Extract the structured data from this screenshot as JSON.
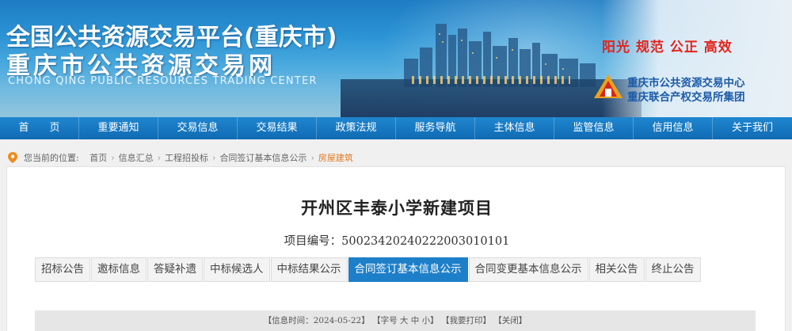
{
  "banner": {
    "title_line1": "全国公共资源交易平台(重庆市)",
    "title_line2": "重庆市公共资源交易网",
    "subtitle": "CHONG QING PUBLIC RESOURCES TRADING CENTER",
    "slogan": "阳光  规范  公正  高效",
    "org_line1": "重庆市公共资源交易中心",
    "org_line2": "重庆联合产权交易所集团"
  },
  "nav": {
    "items": [
      "首　　页",
      "重要通知",
      "交易信息",
      "交易结果",
      "政策法规",
      "服务导航",
      "主体信息",
      "监管信息",
      "信用信息",
      "关于我们"
    ]
  },
  "breadcrumb": {
    "prefix": "您当前的位置:",
    "items": [
      "首页",
      "信息汇总",
      "工程招投标",
      "合同签订基本信息公示"
    ],
    "current": "房屋建筑"
  },
  "main": {
    "title": "开州区丰泰小学新建项目",
    "project_code": "项目编号：500234202402220030101​01",
    "tabs": [
      "招标公告",
      "邀标信息",
      "答疑补遗",
      "中标候选人",
      "中标结果公示",
      "合同签订基本信息公示",
      "合同变更基本信息公示",
      "相关公告",
      "终止公告"
    ],
    "active_tab": 5,
    "info": {
      "time_label": "【信息时间：2024-05-22】",
      "font_label": "【字号",
      "font_large": "大",
      "font_mid": "中",
      "font_small": "小】",
      "print": "【我要打印】",
      "close": "【关闭】"
    }
  },
  "colors": {
    "nav_blue": "#1a7bc4",
    "active_tab": "#1e7fc9",
    "slogan_red": "#e3241b",
    "crumb_orange": "#e07a1f"
  }
}
